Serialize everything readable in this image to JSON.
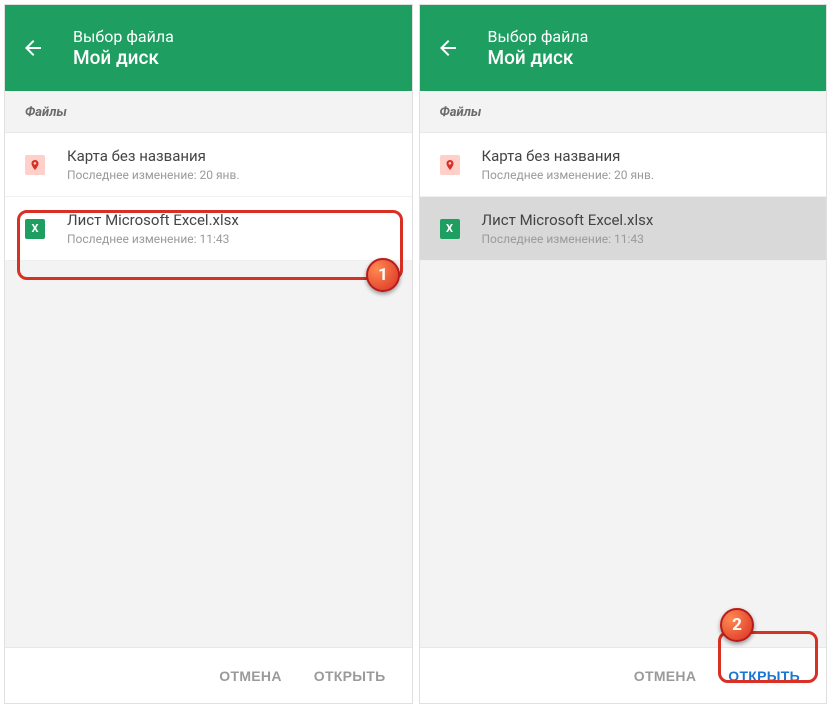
{
  "header": {
    "subtitle": "Выбор файла",
    "title": "Мой диск"
  },
  "section_label": "Файлы",
  "files": [
    {
      "name": "Карта без названия",
      "meta": "Последнее изменение: 20 янв."
    },
    {
      "name": "Лист Microsoft Excel.xlsx",
      "meta": "Последнее изменение: 11:43"
    }
  ],
  "footer": {
    "cancel": "ОТМЕНА",
    "open": "ОТКРЫТЬ"
  },
  "badges": {
    "step1": "1",
    "step2": "2"
  },
  "icons": {
    "excel_glyph": "X"
  }
}
